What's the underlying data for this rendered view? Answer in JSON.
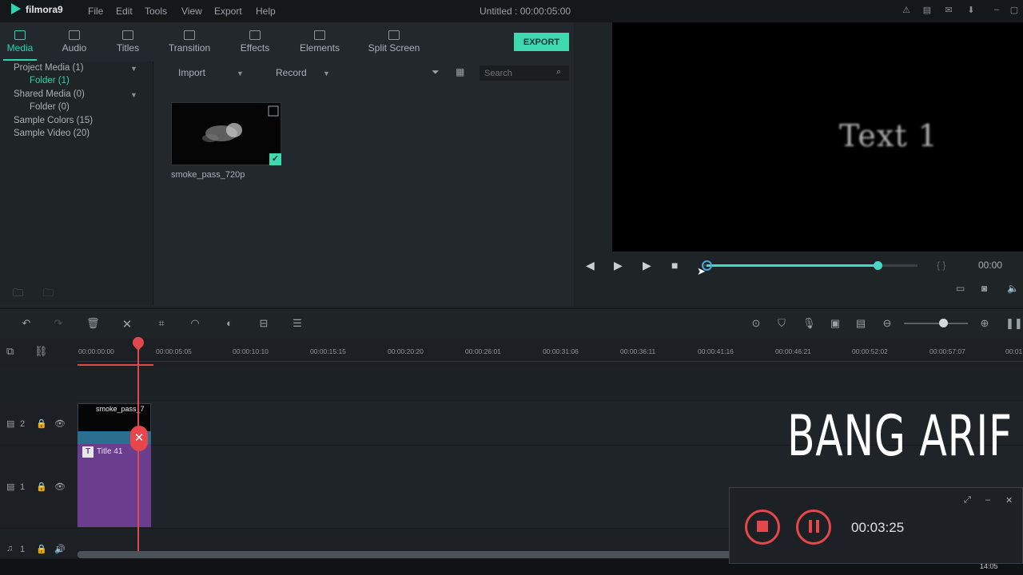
{
  "app": {
    "logo": "filmora9",
    "menu": [
      "File",
      "Edit",
      "Tools",
      "View",
      "Export",
      "Help"
    ],
    "document_title": "Untitled : 00:00:05:00"
  },
  "tabs": [
    {
      "label": "Media",
      "icon": "folder-icon",
      "active": true
    },
    {
      "label": "Audio",
      "icon": "music-note-icon"
    },
    {
      "label": "Titles",
      "icon": "text-icon"
    },
    {
      "label": "Transition",
      "icon": "transition-icon"
    },
    {
      "label": "Effects",
      "icon": "effects-icon"
    },
    {
      "label": "Elements",
      "icon": "elements-icon"
    },
    {
      "label": "Split Screen",
      "icon": "split-screen-icon"
    }
  ],
  "export_label": "EXPORT",
  "sidebar": {
    "items": [
      "Project Media (1)",
      "Folder (1)",
      "Shared Media (0)",
      "Folder (0)",
      "Sample Colors (15)",
      "Sample Video (20)"
    ]
  },
  "media_toolbar": {
    "import_label": "Import",
    "record_label": "Record",
    "search_placeholder": "Search"
  },
  "media_item": {
    "name": "smoke_pass_720p"
  },
  "preview": {
    "overlay_text": "Text 1",
    "timecode": "00:00",
    "progress": 0.8
  },
  "timeline": {
    "ruler_labels": [
      "00:00:00:00",
      "00:00:05:05",
      "00:00:10:10",
      "00:00:15:15",
      "00:00:20:20",
      "00:00:26:01",
      "00:00:31:06",
      "00:00:36:11",
      "00:00:41:16",
      "00:00:46:21",
      "00:00:52:02",
      "00:00:57:07",
      "00:01"
    ],
    "video_clip_label": "smoke_pass_7",
    "title_clip_label": "Title 41",
    "track_numbers": [
      "2",
      "1",
      "1"
    ]
  },
  "watermark": "BANG ARIF",
  "recorder": {
    "time": "00:03:25"
  },
  "taskbar": {
    "time": "14:05"
  },
  "colors": {
    "accent": "#2fd3b0",
    "playhead": "#e0484b",
    "title_clip": "#6a3d8e",
    "recorder_red": "#e5484b"
  }
}
